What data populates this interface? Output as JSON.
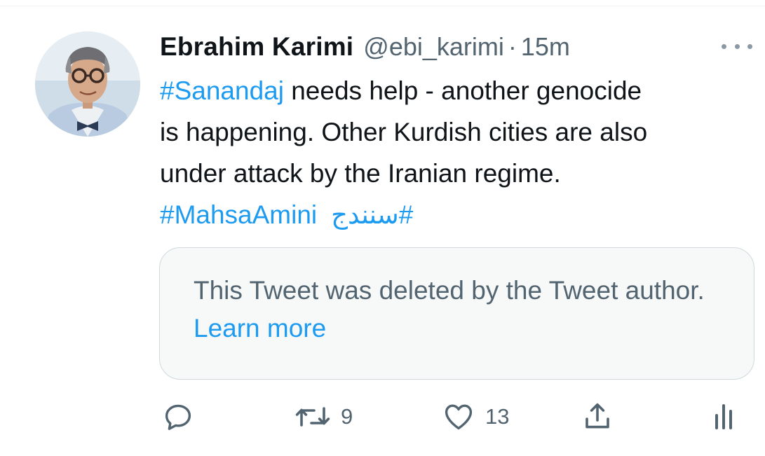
{
  "tweet": {
    "author_name": "Ebrahim Karimi",
    "handle": "@ebi_karimi",
    "separator": "·",
    "time": "15m",
    "text": {
      "hashtag1": "#Sanandaj",
      "line1_rest": " needs help - another genocide",
      "line2": "is happening. Other Kurdish cities are also",
      "line3": "under attack by the Iranian regime.",
      "hashtag2": "#MahsaAmini",
      "hashtag3": "#سنندج"
    }
  },
  "quoted": {
    "message": "This Tweet was deleted by the Tweet author.",
    "link": "Learn more"
  },
  "actions": {
    "reply": {
      "icon": "reply-icon",
      "count": ""
    },
    "retweet": {
      "icon": "retweet-icon",
      "count": "9"
    },
    "like": {
      "icon": "heart-icon",
      "count": "13"
    },
    "share": {
      "icon": "share-icon"
    },
    "analytics": {
      "icon": "analytics-icon"
    }
  },
  "colors": {
    "link": "#1d9bf0",
    "secondary_text": "#536471",
    "primary_text": "#0f1419",
    "card_border": "#cfd9de",
    "card_bg": "#f7f9f9"
  }
}
